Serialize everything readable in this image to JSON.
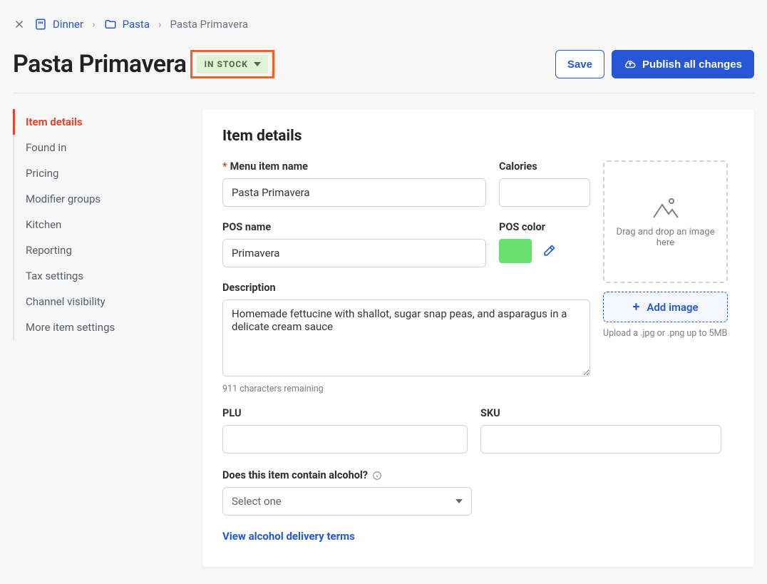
{
  "breadcrumb": {
    "menu": "Dinner",
    "category": "Pasta",
    "current": "Pasta Primavera"
  },
  "header": {
    "title": "Pasta Primavera",
    "stock_status": "IN STOCK",
    "save_label": "Save",
    "publish_label": "Publish all changes"
  },
  "sidenav": {
    "items": [
      "Item details",
      "Found in",
      "Pricing",
      "Modifier groups",
      "Kitchen",
      "Reporting",
      "Tax settings",
      "Channel visibility",
      "More item settings"
    ],
    "active_index": 0
  },
  "panel": {
    "heading": "Item details",
    "menu_item_label": "Menu item name",
    "menu_item_value": "Pasta Primavera",
    "calories_label": "Calories",
    "calories_value": "",
    "pos_name_label": "POS name",
    "pos_name_value": "Primavera",
    "pos_color_label": "POS color",
    "pos_color_hex": "#66e06a",
    "description_label": "Description",
    "description_value": "Homemade fettucine with shallot, sugar snap peas, and asparagus in a delicate cream sauce",
    "description_remaining": "911 characters remaining",
    "plu_label": "PLU",
    "plu_value": "",
    "sku_label": "SKU",
    "sku_value": "",
    "dropzone_text": "Drag and drop an image here",
    "add_image_label": "Add image",
    "upload_hint": "Upload a .jpg or .png up to 5MB",
    "alcohol_label": "Does this item contain alcohol?",
    "alcohol_placeholder": "Select one",
    "alcohol_link": "View alcohol delivery terms"
  }
}
